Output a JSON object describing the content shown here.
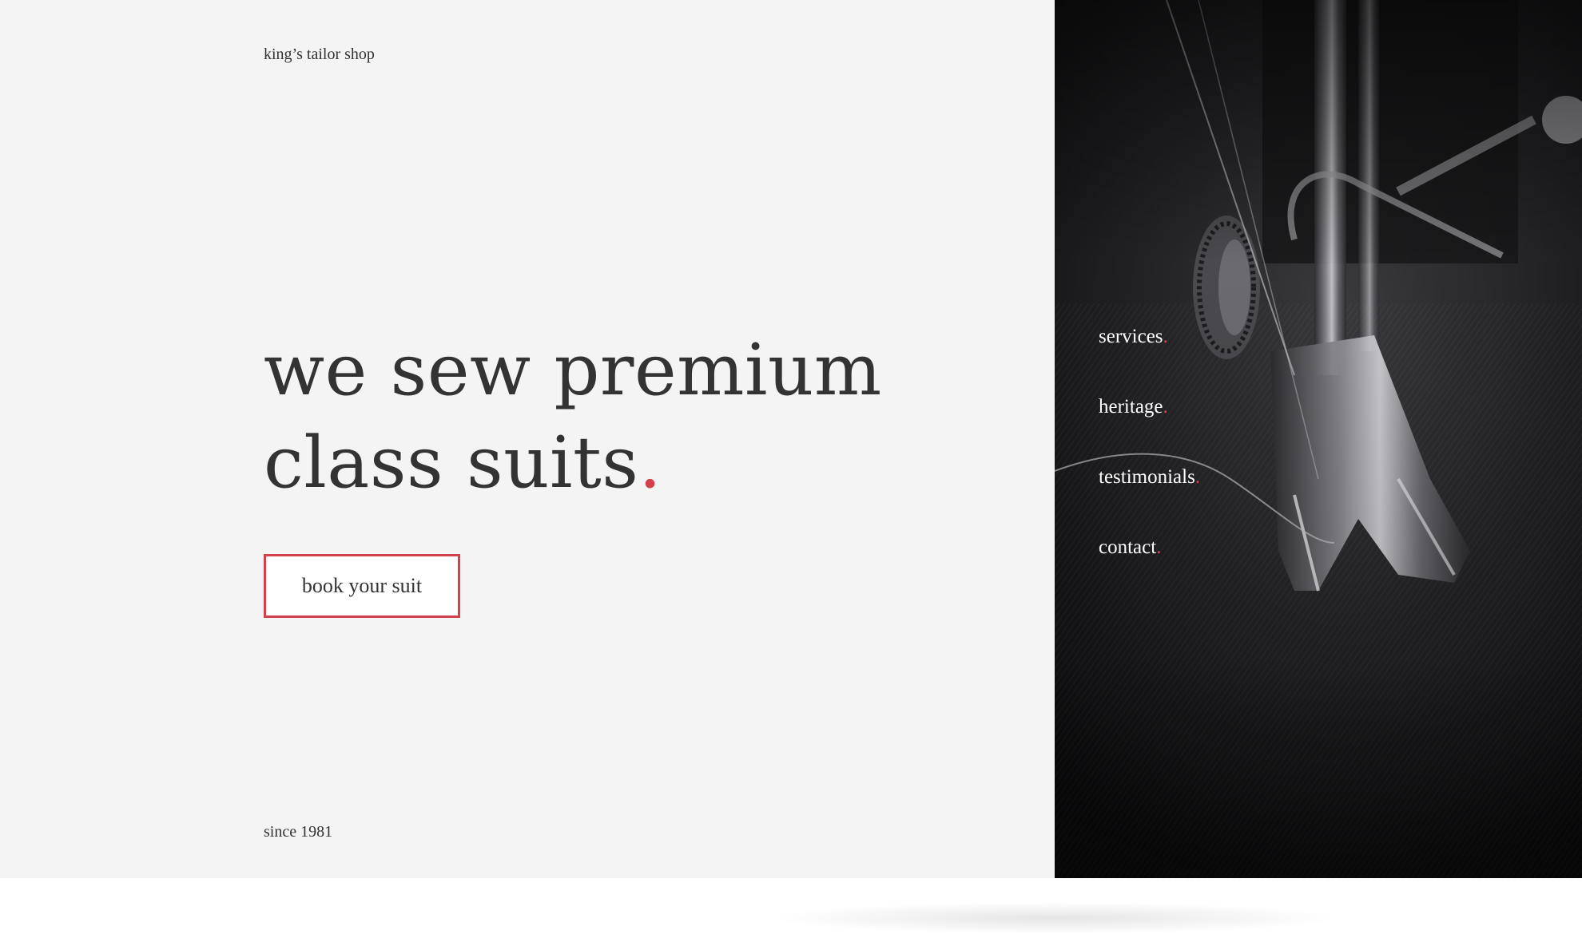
{
  "brand": {
    "name": "king’s tailor shop"
  },
  "hero": {
    "headline_line1": "we sew premium",
    "headline_line2": "class suits",
    "headline_dot": "."
  },
  "cta": {
    "label": "book your suit"
  },
  "footer": {
    "since": "since 1981"
  },
  "nav": {
    "items": [
      {
        "label": "services",
        "dot": "."
      },
      {
        "label": "heritage",
        "dot": "."
      },
      {
        "label": "testimonials",
        "dot": "."
      },
      {
        "label": "contact",
        "dot": "."
      }
    ]
  },
  "photo": {
    "subject": "sewing-machine-presser-foot-on-dark-fabric"
  },
  "colors": {
    "accent": "#d3414e",
    "text": "#333333",
    "panel_background": "#f4f4f4",
    "nav_text": "#ffffff"
  }
}
